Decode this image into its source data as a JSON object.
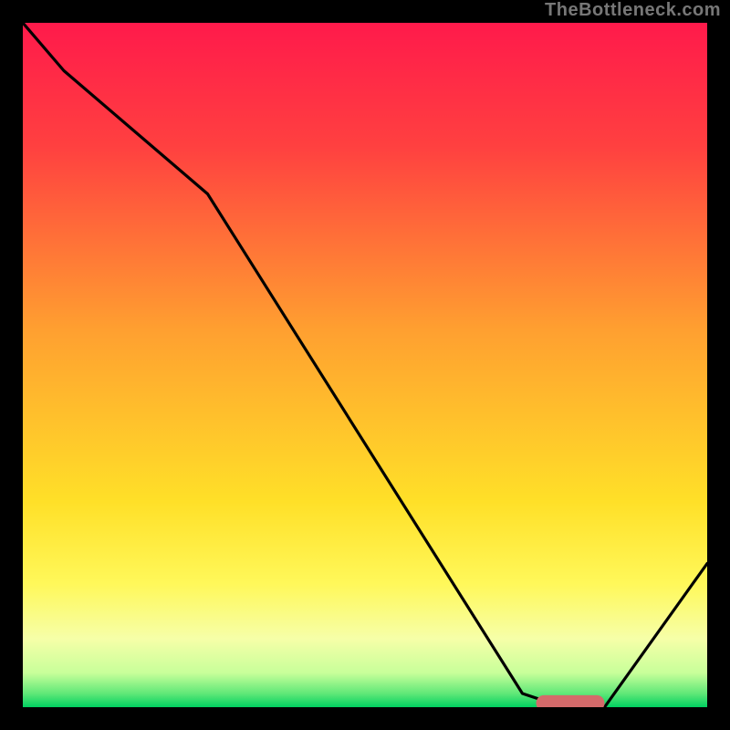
{
  "watermark": "TheBottleneck.com",
  "chart_data": {
    "type": "line",
    "title": "",
    "xlabel": "",
    "ylabel": "",
    "xlim": [
      0,
      100
    ],
    "ylim": [
      0,
      100
    ],
    "gradient_stops": [
      {
        "offset": 0,
        "color": "#ff1a4b"
      },
      {
        "offset": 18,
        "color": "#ff4040"
      },
      {
        "offset": 45,
        "color": "#ffa030"
      },
      {
        "offset": 70,
        "color": "#ffe028"
      },
      {
        "offset": 82,
        "color": "#fff85a"
      },
      {
        "offset": 90,
        "color": "#f6ffa8"
      },
      {
        "offset": 95,
        "color": "#c8ff9a"
      },
      {
        "offset": 98,
        "color": "#60e878"
      },
      {
        "offset": 100,
        "color": "#00d060"
      }
    ],
    "series": [
      {
        "name": "bottleneck-curve",
        "color": "#000000",
        "x": [
          0,
          6,
          27,
          73,
          79,
          85,
          100
        ],
        "y": [
          100,
          93,
          75,
          2,
          0,
          0,
          21
        ]
      }
    ],
    "marker": {
      "name": "optimal-range",
      "color": "#d46a6a",
      "x_start": 75,
      "x_end": 85,
      "y": 0.6,
      "thickness": 2.3
    }
  }
}
